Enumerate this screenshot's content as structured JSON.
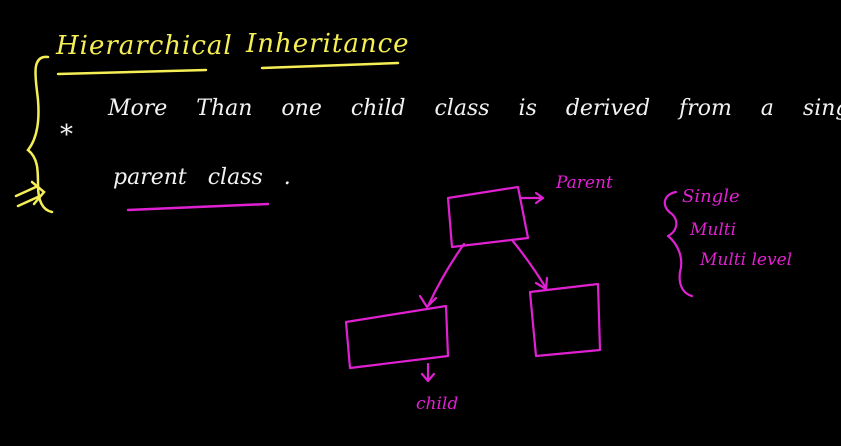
{
  "heading": {
    "word1": "Hierarchical",
    "word2": "Inheritance"
  },
  "definition": {
    "bullet": "*",
    "line1": "More Than one child class is derived from a single",
    "line2": "parent class ."
  },
  "diagram": {
    "parent_label": "Parent",
    "child_label": "child"
  },
  "inheritance_types": [
    "Single",
    "Multi",
    "Multi level"
  ],
  "colors": {
    "background": "#000000",
    "heading": "#f5ef55",
    "body_text": "#f2f2f2",
    "diagram": "#e021d2"
  }
}
